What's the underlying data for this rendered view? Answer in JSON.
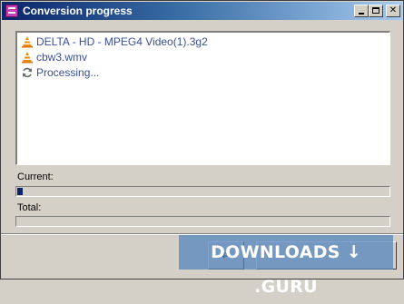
{
  "window": {
    "title": "Conversion progress"
  },
  "list": {
    "items": [
      {
        "label": "DELTA - HD - MPEG4 Video(1).3g2",
        "icon": "vlc-cone-icon"
      },
      {
        "label": "cbw3.wmv",
        "icon": "vlc-cone-icon"
      },
      {
        "label": "Processing...",
        "icon": "refresh-icon"
      }
    ]
  },
  "progress": {
    "current_label": "Current:",
    "current_fraction": 0.015,
    "total_label": "Total:",
    "total_fraction": 0.0
  },
  "watermark": {
    "text": "DOWNLOADS ↓ .GURU"
  },
  "colors": {
    "titlebar_start": "#0a246a",
    "titlebar_end": "#a6caf0",
    "progress_fill": "#0a246a",
    "list_text": "#3a4f9a"
  }
}
